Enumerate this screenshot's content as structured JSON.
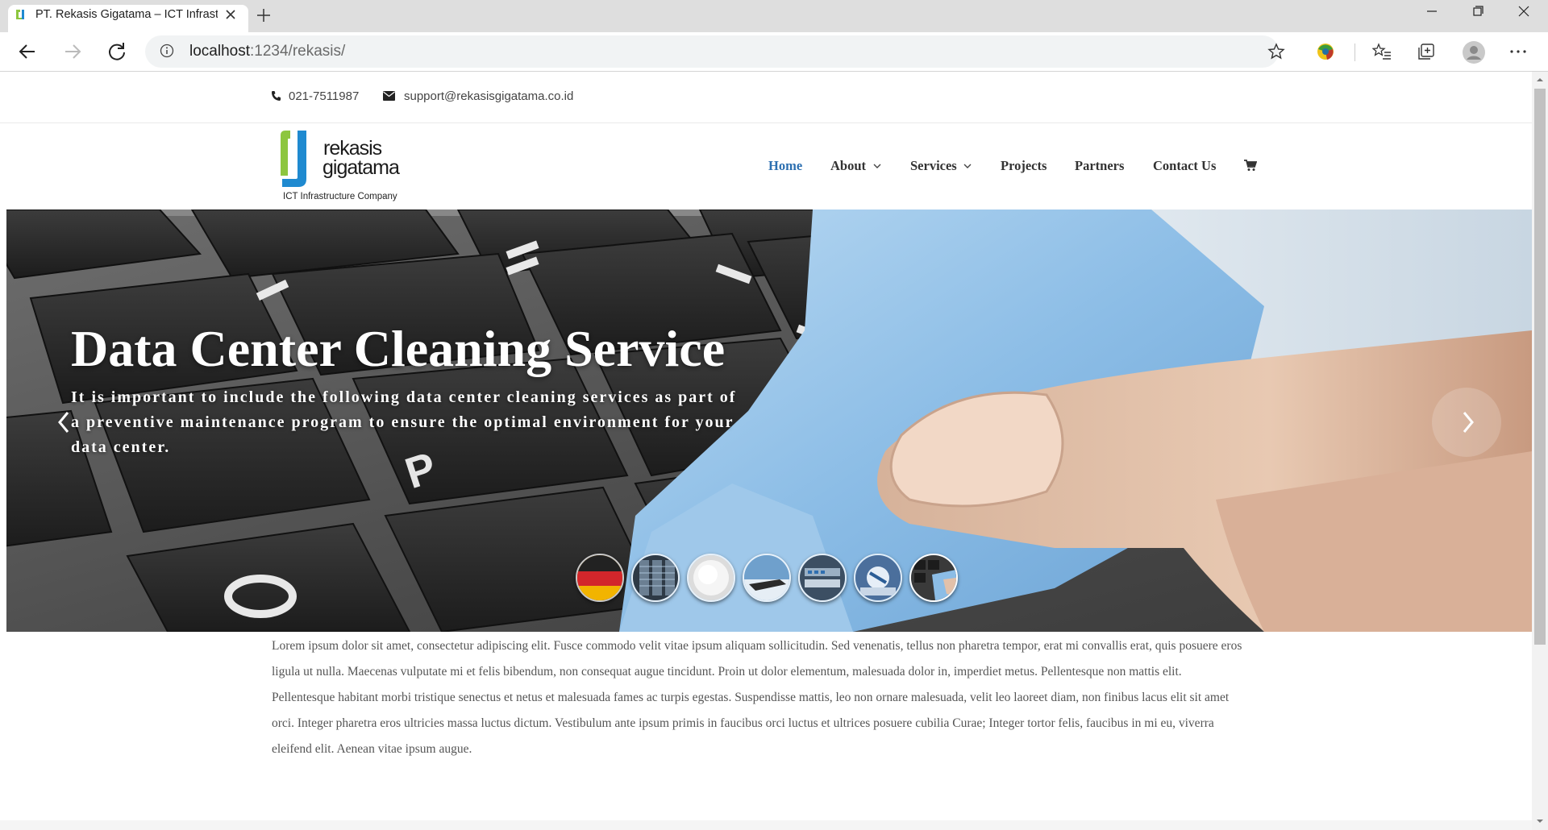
{
  "browser": {
    "tab_title": "PT. Rekasis Gigatama – ICT Infrastructure Company",
    "url_host": "localhost",
    "url_rest": ":1234/rekasis/"
  },
  "topbar": {
    "phone": "021-7511987",
    "email": "support@rekasisgigatama.co.id"
  },
  "logo": {
    "word1": "rekasis",
    "word2": "gigatama",
    "tagline": "ICT Infrastructure Company",
    "colors": {
      "green": "#8dc63f",
      "blue": "#1f8ad0"
    }
  },
  "nav": {
    "home": "Home",
    "about": "About",
    "services": "Services",
    "projects": "Projects",
    "partners": "Partners",
    "contact": "Contact Us",
    "active_color": "#2c6fb0"
  },
  "hero": {
    "title": "Data Center Cleaning Service",
    "text": "It is important to include the following data center cleaning services as part of a preventive maintenance program to ensure the optimal environment for your data center.",
    "slide_count": 7,
    "active_slide": 7
  },
  "content": {
    "body": "Lorem ipsum dolor sit amet, consectetur adipiscing elit. Fusce commodo velit vitae ipsum aliquam sollicitudin. Sed venenatis, tellus non pharetra tempor, erat mi convallis erat, quis posuere eros ligula ut nulla. Maecenas vulputate mi et felis bibendum, non consequat augue tincidunt. Proin ut dolor elementum, malesuada dolor in, imperdiet metus. Pellentesque non mattis elit. Pellentesque habitant morbi tristique senectus et netus et malesuada fames ac turpis egestas. Suspendisse mattis, leo non ornare malesuada, velit leo laoreet diam, non finibus lacus elit sit amet orci. Integer pharetra eros ultricies massa luctus dictum. Vestibulum ante ipsum primis in faucibus orci luctus et ultrices posuere cubilia Curae; Integer tortor felis, faucibus in mi eu, viverra eleifend elit. Aenean vitae ipsum augue."
  }
}
